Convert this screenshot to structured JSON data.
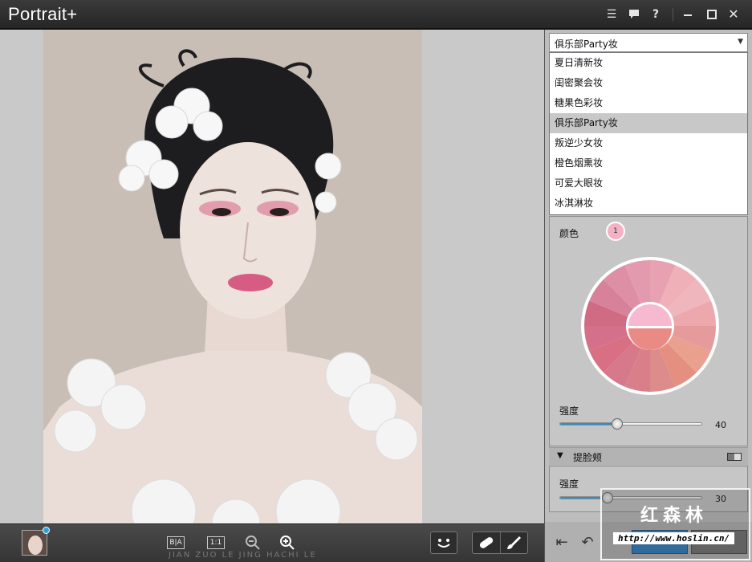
{
  "app": {
    "title": "Portrait+",
    "icons": [
      "list-icon",
      "chat-icon",
      "help-icon",
      "minimize-icon",
      "maximize-icon",
      "close-icon"
    ]
  },
  "bottombar": {
    "buttons": [
      "before-after-icon",
      "one-to-one-icon",
      "zoom-out-icon",
      "zoom-in-icon",
      "face-icon",
      "bandage-icon",
      "brush-icon"
    ],
    "before_after_label": "B|A",
    "one_to_one_label": "1:1",
    "faint_text": "JIAN ZUO LE JING HACHI LE"
  },
  "panel": {
    "makeup_select": {
      "value": "俱乐部Party妆",
      "options": [
        "夏日清新妆",
        "闺密聚会妆",
        "糖果色彩妆",
        "俱乐部Party妆",
        "叛逆少女妆",
        "橙色烟熏妆",
        "可爱大眼妆",
        "冰淇淋妆"
      ],
      "selected_index": 3
    },
    "color_section": {
      "label": "颜色",
      "badge": "1",
      "wheel_colors": [
        "#e7a1b0",
        "#efb0b8",
        "#f0b6bd",
        "#eca8ad",
        "#e59a9c",
        "#eaa08e",
        "#e58f80",
        "#dd8c8c",
        "#d97f8a",
        "#d6798a",
        "#d86f82",
        "#d5708a",
        "#cf6b82",
        "#d7819a",
        "#de8ea5",
        "#e49aae"
      ],
      "center_top": "#f6b9d0",
      "center_bottom": "#e98b84",
      "intensity_label": "强度",
      "intensity_value": "40",
      "intensity_fraction": 0.4
    },
    "contour_section": {
      "title": "提脸颊",
      "intensity_label": "强度",
      "intensity_value": "30",
      "intensity_fraction": 0.33
    },
    "footer_icons": [
      "undo-all-icon",
      "undo-icon"
    ]
  },
  "watermark": {
    "text": "红森林",
    "url": "http://www.hoslin.cn/"
  }
}
